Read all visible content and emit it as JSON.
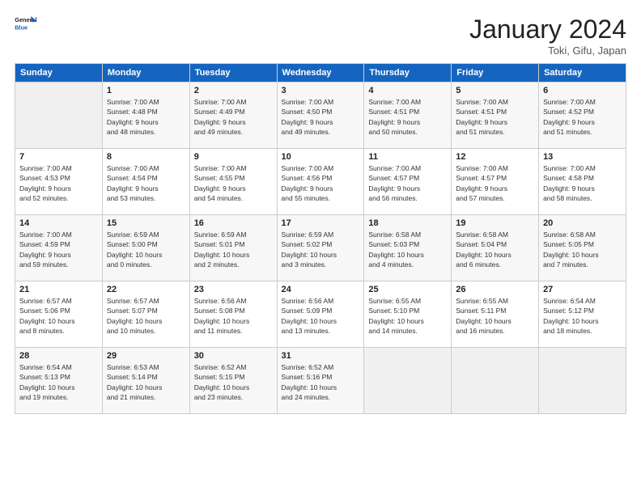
{
  "header": {
    "logo_general": "General",
    "logo_blue": "Blue",
    "title": "January 2024",
    "location": "Toki, Gifu, Japan"
  },
  "days_of_week": [
    "Sunday",
    "Monday",
    "Tuesday",
    "Wednesday",
    "Thursday",
    "Friday",
    "Saturday"
  ],
  "weeks": [
    [
      {
        "day": "",
        "info": ""
      },
      {
        "day": "1",
        "info": "Sunrise: 7:00 AM\nSunset: 4:48 PM\nDaylight: 9 hours\nand 48 minutes."
      },
      {
        "day": "2",
        "info": "Sunrise: 7:00 AM\nSunset: 4:49 PM\nDaylight: 9 hours\nand 49 minutes."
      },
      {
        "day": "3",
        "info": "Sunrise: 7:00 AM\nSunset: 4:50 PM\nDaylight: 9 hours\nand 49 minutes."
      },
      {
        "day": "4",
        "info": "Sunrise: 7:00 AM\nSunset: 4:51 PM\nDaylight: 9 hours\nand 50 minutes."
      },
      {
        "day": "5",
        "info": "Sunrise: 7:00 AM\nSunset: 4:51 PM\nDaylight: 9 hours\nand 51 minutes."
      },
      {
        "day": "6",
        "info": "Sunrise: 7:00 AM\nSunset: 4:52 PM\nDaylight: 9 hours\nand 51 minutes."
      }
    ],
    [
      {
        "day": "7",
        "info": "Sunrise: 7:00 AM\nSunset: 4:53 PM\nDaylight: 9 hours\nand 52 minutes."
      },
      {
        "day": "8",
        "info": "Sunrise: 7:00 AM\nSunset: 4:54 PM\nDaylight: 9 hours\nand 53 minutes."
      },
      {
        "day": "9",
        "info": "Sunrise: 7:00 AM\nSunset: 4:55 PM\nDaylight: 9 hours\nand 54 minutes."
      },
      {
        "day": "10",
        "info": "Sunrise: 7:00 AM\nSunset: 4:56 PM\nDaylight: 9 hours\nand 55 minutes."
      },
      {
        "day": "11",
        "info": "Sunrise: 7:00 AM\nSunset: 4:57 PM\nDaylight: 9 hours\nand 56 minutes."
      },
      {
        "day": "12",
        "info": "Sunrise: 7:00 AM\nSunset: 4:57 PM\nDaylight: 9 hours\nand 57 minutes."
      },
      {
        "day": "13",
        "info": "Sunrise: 7:00 AM\nSunset: 4:58 PM\nDaylight: 9 hours\nand 58 minutes."
      }
    ],
    [
      {
        "day": "14",
        "info": "Sunrise: 7:00 AM\nSunset: 4:59 PM\nDaylight: 9 hours\nand 59 minutes."
      },
      {
        "day": "15",
        "info": "Sunrise: 6:59 AM\nSunset: 5:00 PM\nDaylight: 10 hours\nand 0 minutes."
      },
      {
        "day": "16",
        "info": "Sunrise: 6:59 AM\nSunset: 5:01 PM\nDaylight: 10 hours\nand 2 minutes."
      },
      {
        "day": "17",
        "info": "Sunrise: 6:59 AM\nSunset: 5:02 PM\nDaylight: 10 hours\nand 3 minutes."
      },
      {
        "day": "18",
        "info": "Sunrise: 6:58 AM\nSunset: 5:03 PM\nDaylight: 10 hours\nand 4 minutes."
      },
      {
        "day": "19",
        "info": "Sunrise: 6:58 AM\nSunset: 5:04 PM\nDaylight: 10 hours\nand 6 minutes."
      },
      {
        "day": "20",
        "info": "Sunrise: 6:58 AM\nSunset: 5:05 PM\nDaylight: 10 hours\nand 7 minutes."
      }
    ],
    [
      {
        "day": "21",
        "info": "Sunrise: 6:57 AM\nSunset: 5:06 PM\nDaylight: 10 hours\nand 8 minutes."
      },
      {
        "day": "22",
        "info": "Sunrise: 6:57 AM\nSunset: 5:07 PM\nDaylight: 10 hours\nand 10 minutes."
      },
      {
        "day": "23",
        "info": "Sunrise: 6:56 AM\nSunset: 5:08 PM\nDaylight: 10 hours\nand 11 minutes."
      },
      {
        "day": "24",
        "info": "Sunrise: 6:56 AM\nSunset: 5:09 PM\nDaylight: 10 hours\nand 13 minutes."
      },
      {
        "day": "25",
        "info": "Sunrise: 6:55 AM\nSunset: 5:10 PM\nDaylight: 10 hours\nand 14 minutes."
      },
      {
        "day": "26",
        "info": "Sunrise: 6:55 AM\nSunset: 5:11 PM\nDaylight: 10 hours\nand 16 minutes."
      },
      {
        "day": "27",
        "info": "Sunrise: 6:54 AM\nSunset: 5:12 PM\nDaylight: 10 hours\nand 18 minutes."
      }
    ],
    [
      {
        "day": "28",
        "info": "Sunrise: 6:54 AM\nSunset: 5:13 PM\nDaylight: 10 hours\nand 19 minutes."
      },
      {
        "day": "29",
        "info": "Sunrise: 6:53 AM\nSunset: 5:14 PM\nDaylight: 10 hours\nand 21 minutes."
      },
      {
        "day": "30",
        "info": "Sunrise: 6:52 AM\nSunset: 5:15 PM\nDaylight: 10 hours\nand 23 minutes."
      },
      {
        "day": "31",
        "info": "Sunrise: 6:52 AM\nSunset: 5:16 PM\nDaylight: 10 hours\nand 24 minutes."
      },
      {
        "day": "",
        "info": ""
      },
      {
        "day": "",
        "info": ""
      },
      {
        "day": "",
        "info": ""
      }
    ]
  ]
}
